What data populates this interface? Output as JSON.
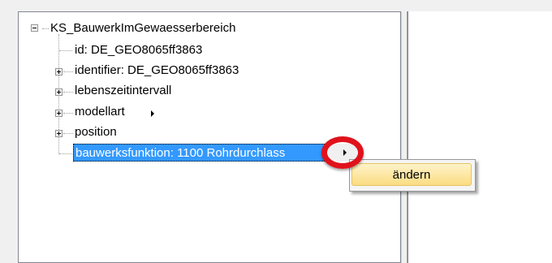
{
  "tree": {
    "root": {
      "label": "KS_BauwerkImGewaesserbereich",
      "expanded": true
    },
    "children": [
      {
        "label": "id: DE_GEO8065ff3863",
        "expandable": false
      },
      {
        "label": "identifier: DE_GEO8065ff3863",
        "expandable": true
      },
      {
        "label": "lebenszeitintervall",
        "expandable": true
      },
      {
        "label": "modellart",
        "expandable": true,
        "has_arrow": true
      },
      {
        "label": "position",
        "expandable": true
      },
      {
        "label": "bauwerksfunktion: 1100 Rohrdurchlass",
        "expandable": false,
        "selected": true,
        "has_arrow": true
      }
    ]
  },
  "context_menu": {
    "items": [
      {
        "label": "ändern"
      }
    ]
  },
  "colors": {
    "selection": "#3399ff",
    "highlight_ring": "#e0121b",
    "menu_hover": "#fbdc82"
  }
}
